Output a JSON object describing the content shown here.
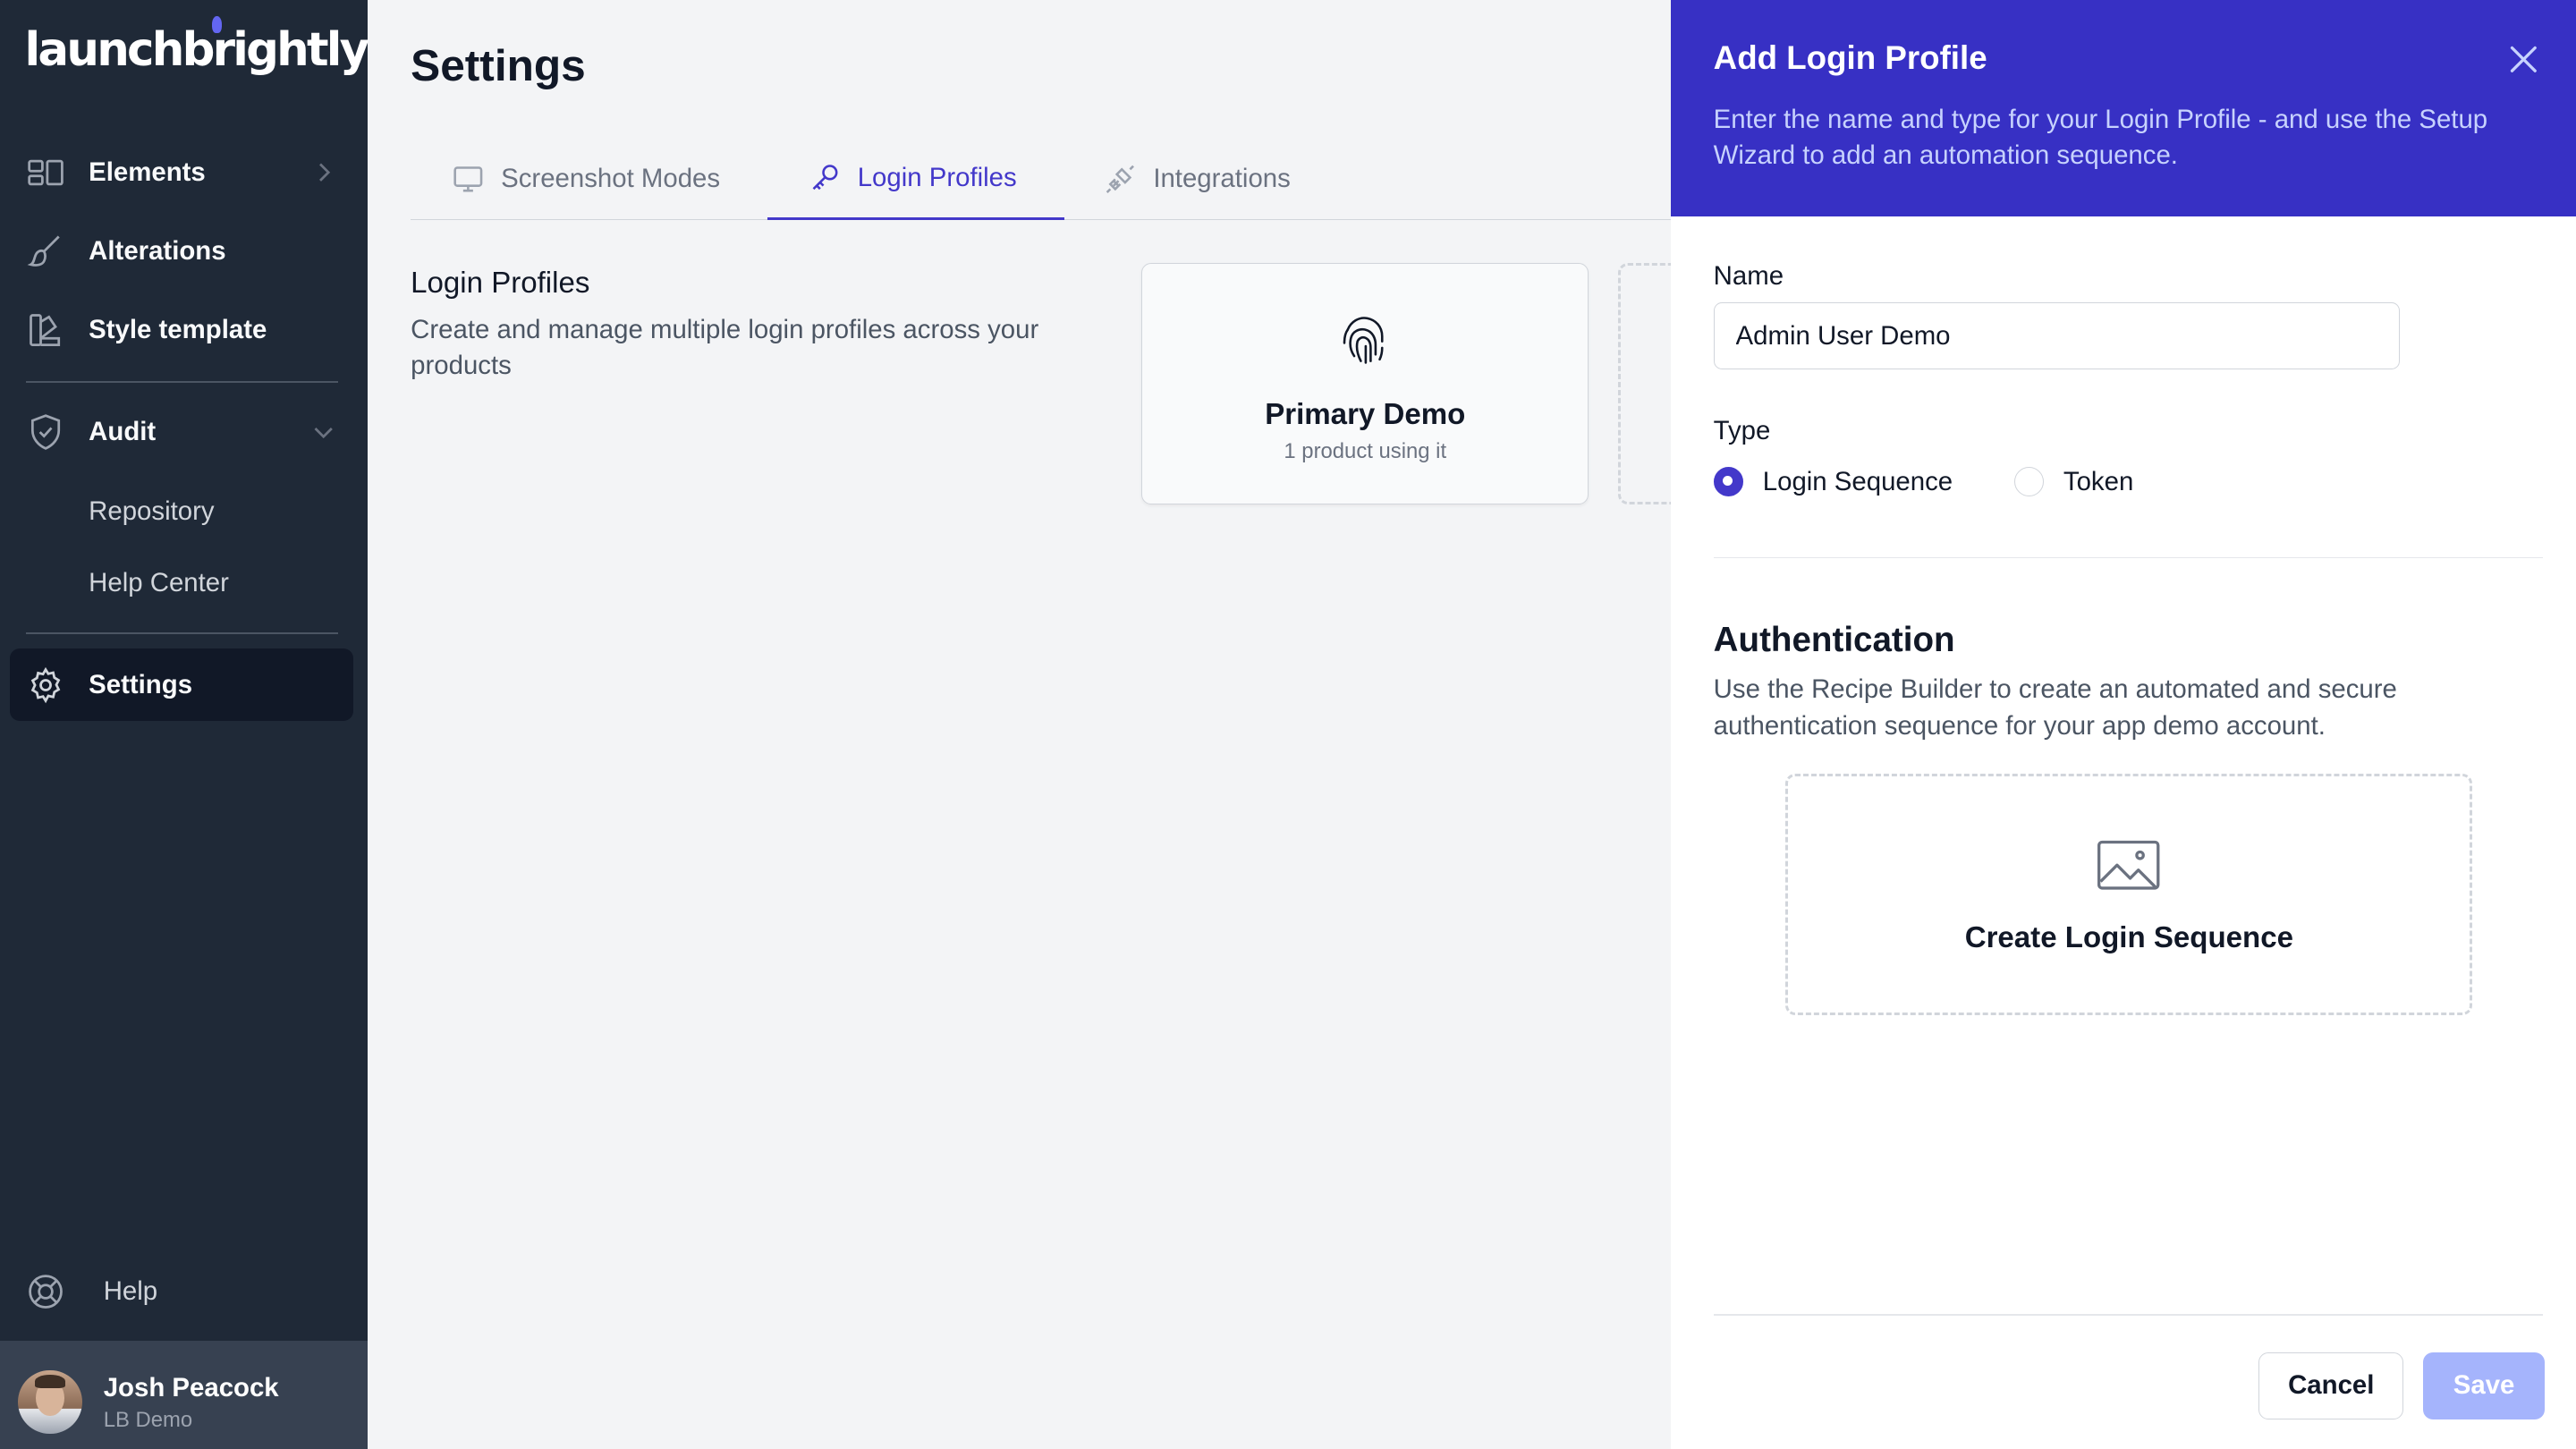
{
  "sidebar": {
    "logo": "launchbrightly",
    "nav": [
      {
        "label": "Elements",
        "icon": "elements-icon"
      },
      {
        "label": "Alterations",
        "icon": "brush-icon"
      },
      {
        "label": "Style template",
        "icon": "palette-icon"
      },
      {
        "label": "Audit",
        "icon": "shield-check-icon"
      }
    ],
    "sub_items": [
      "Repository",
      "Help Center"
    ],
    "settings_label": "Settings",
    "help_label": "Help",
    "user": {
      "name": "Josh Peacock",
      "org": "LB Demo"
    }
  },
  "main": {
    "title": "Settings",
    "tabs": [
      {
        "label": "Screenshot Modes",
        "icon": "monitor-icon",
        "active": false
      },
      {
        "label": "Login Profiles",
        "icon": "key-icon",
        "active": true
      },
      {
        "label": "Integrations",
        "icon": "plug-icon",
        "active": false
      }
    ],
    "section_title": "Login Profiles",
    "section_desc": "Create and manage multiple login profiles across your products",
    "profile_card": {
      "title": "Primary Demo",
      "subtitle": "1 product using it"
    }
  },
  "panel": {
    "title": "Add Login Profile",
    "description": "Enter the name and type for your Login Profile - and use the Setup Wizard to add an automation sequence.",
    "name_label": "Name",
    "name_value": "Admin User Demo",
    "type_label": "Type",
    "type_options": [
      {
        "label": "Login Sequence",
        "selected": true
      },
      {
        "label": "Token",
        "selected": false
      }
    ],
    "auth_title": "Authentication",
    "auth_desc": "Use the Recipe Builder to create an automated and secure authentication sequence for your app demo account.",
    "create_label": "Create Login Sequence",
    "cancel_label": "Cancel",
    "save_label": "Save"
  },
  "colors": {
    "sidebar_bg": "#1f2937",
    "accent": "#4338ca",
    "panel_header": "#3730c4",
    "save_disabled": "#a5b4fc"
  }
}
